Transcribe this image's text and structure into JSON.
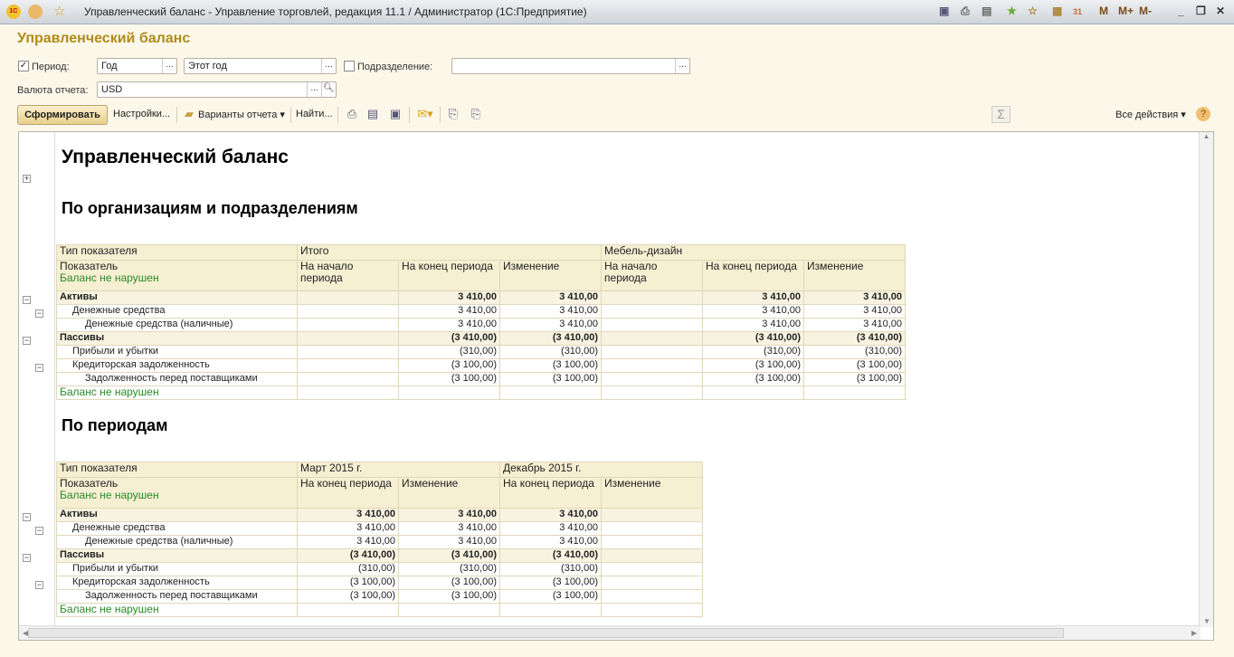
{
  "window": {
    "title": "Управленческий баланс - Управление торговлей, редакция 11.1 / Администратор  (1С:Предприятие)",
    "right_icons": [
      "save-icon",
      "print-icon",
      "preview-icon",
      "add-favorite-icon",
      "favorites-icon",
      "calculator-icon",
      "calendar-icon"
    ],
    "m": "M",
    "mplus": "M+",
    "mminus": "M-",
    "minimize": "_",
    "restore": "❐",
    "close": "✕"
  },
  "form": {
    "title": "Управленческий баланс",
    "period_label": "Период:",
    "period_checked": true,
    "period_kind": "Год",
    "period_value": "Этот год",
    "division_label": "Подразделение:",
    "division_checked": false,
    "division_value": "",
    "currency_label": "Валюта отчета:",
    "currency_value": "USD"
  },
  "toolbar": {
    "generate": "Сформировать",
    "settings": "Настройки...",
    "variants": "Варианты отчета",
    "find": "Найти...",
    "all_actions": "Все действия",
    "sum": "Σ",
    "help": "?"
  },
  "report": {
    "title": "Управленческий баланс",
    "section1": "По организациям и подразделениям",
    "section2": "По периодам",
    "table1": {
      "header1": [
        "Тип показателя",
        "Итого",
        "Мебель-дизайн"
      ],
      "header2": [
        "Показатель",
        "На начало периода",
        "На конец периода",
        "Изменение",
        "На начало периода",
        "На конец периода",
        "Изменение"
      ],
      "status": "Баланс не нарушен",
      "rows": [
        {
          "label": "Активы",
          "level": 0,
          "bold": true,
          "values": [
            "",
            "3 410,00",
            "3 410,00",
            "",
            "3 410,00",
            "3 410,00"
          ]
        },
        {
          "label": "Денежные средства",
          "level": 1,
          "values": [
            "",
            "3 410,00",
            "3 410,00",
            "",
            "3 410,00",
            "3 410,00"
          ]
        },
        {
          "label": "Денежные средства (наличные)",
          "level": 2,
          "values": [
            "",
            "3 410,00",
            "3 410,00",
            "",
            "3 410,00",
            "3 410,00"
          ]
        },
        {
          "label": "Пассивы",
          "level": 0,
          "bold": true,
          "values": [
            "",
            "(3 410,00)",
            "(3 410,00)",
            "",
            "(3 410,00)",
            "(3 410,00)"
          ]
        },
        {
          "label": "Прибыли и убытки",
          "level": 1,
          "values": [
            "",
            "(310,00)",
            "(310,00)",
            "",
            "(310,00)",
            "(310,00)"
          ]
        },
        {
          "label": "Кредиторская задолженность",
          "level": 1,
          "values": [
            "",
            "(3 100,00)",
            "(3 100,00)",
            "",
            "(3 100,00)",
            "(3 100,00)"
          ]
        },
        {
          "label": "Задолженность перед поставщиками",
          "level": 2,
          "values": [
            "",
            "(3 100,00)",
            "(3 100,00)",
            "",
            "(3 100,00)",
            "(3 100,00)"
          ]
        }
      ],
      "footer": "Баланс не нарушен"
    },
    "table2": {
      "header1": [
        "Тип показателя",
        "Март 2015 г.",
        "Декабрь 2015 г."
      ],
      "header2": [
        "Показатель",
        "На конец периода",
        "Изменение",
        "На конец периода",
        "Изменение"
      ],
      "status": "Баланс не нарушен",
      "rows": [
        {
          "label": "Активы",
          "level": 0,
          "bold": true,
          "values": [
            "3 410,00",
            "3 410,00",
            "3 410,00",
            ""
          ]
        },
        {
          "label": "Денежные средства",
          "level": 1,
          "values": [
            "3 410,00",
            "3 410,00",
            "3 410,00",
            ""
          ]
        },
        {
          "label": "Денежные средства (наличные)",
          "level": 2,
          "values": [
            "3 410,00",
            "3 410,00",
            "3 410,00",
            ""
          ]
        },
        {
          "label": "Пассивы",
          "level": 0,
          "bold": true,
          "values": [
            "(3 410,00)",
            "(3 410,00)",
            "(3 410,00)",
            ""
          ]
        },
        {
          "label": "Прибыли и убытки",
          "level": 1,
          "values": [
            "(310,00)",
            "(310,00)",
            "(310,00)",
            ""
          ]
        },
        {
          "label": "Кредиторская задолженность",
          "level": 1,
          "values": [
            "(3 100,00)",
            "(3 100,00)",
            "(3 100,00)",
            ""
          ]
        },
        {
          "label": "Задолженность перед поставщиками",
          "level": 2,
          "values": [
            "(3 100,00)",
            "(3 100,00)",
            "(3 100,00)",
            ""
          ]
        }
      ],
      "footer": "Баланс не нарушен"
    }
  },
  "colors": {
    "accent": "#b08a1a",
    "header_bg": "#f6efd2",
    "status_green": "#2a8a2a"
  }
}
